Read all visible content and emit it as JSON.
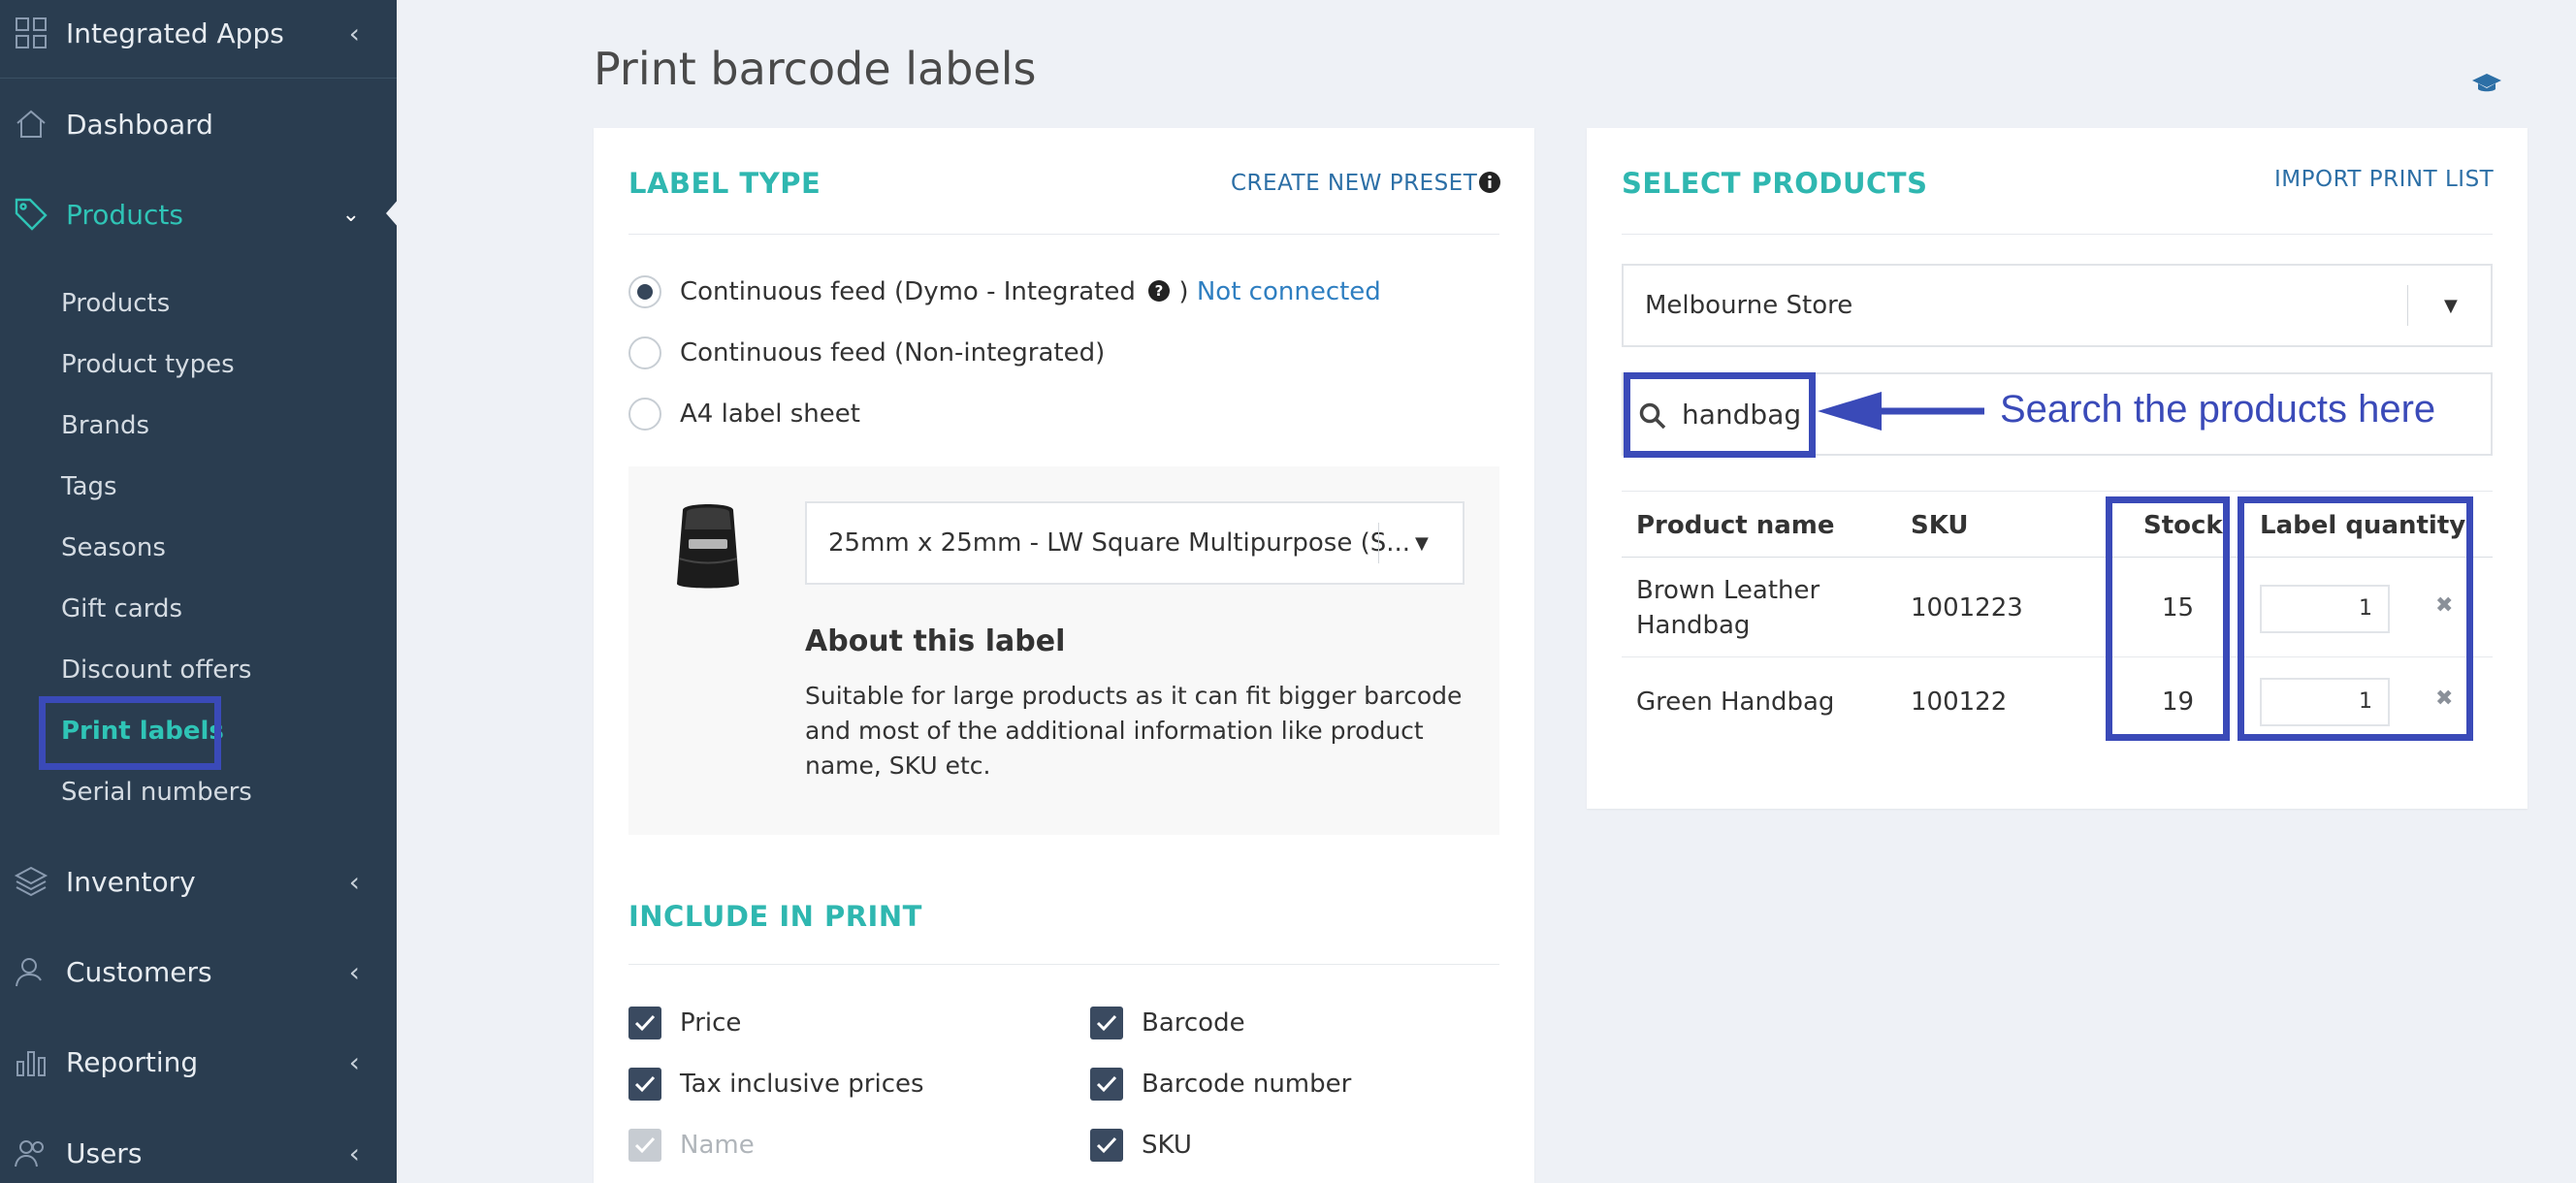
{
  "sidebar": {
    "integrated_apps": "Integrated Apps",
    "dashboard": "Dashboard",
    "products": "Products",
    "sub_items": [
      "Products",
      "Product types",
      "Brands",
      "Tags",
      "Seasons",
      "Gift cards",
      "Discount offers",
      "Print labels",
      "Serial numbers"
    ],
    "inventory": "Inventory",
    "customers": "Customers",
    "reporting": "Reporting",
    "users": "Users"
  },
  "page": {
    "title": "Print barcode labels"
  },
  "label_type": {
    "title": "LABEL TYPE",
    "create_preset": "CREATE NEW PRESET",
    "options": [
      {
        "label": "Continuous feed (Dymo - Integrated",
        "suffix": ")",
        "status": "Not connected",
        "checked": true
      },
      {
        "label": "Continuous feed (Non-integrated)",
        "checked": false
      },
      {
        "label": "A4 label sheet",
        "checked": false
      }
    ],
    "preset_select": "25mm x 25mm - LW Square Multipurpose (S...",
    "about_title": "About this label",
    "about_text": "Suitable for large products as it can fit bigger barcode and most of the additional information like product name, SKU etc."
  },
  "include": {
    "title": "INCLUDE IN PRINT",
    "left": [
      {
        "label": "Price",
        "checked": true,
        "disabled": false
      },
      {
        "label": "Tax inclusive prices",
        "checked": true,
        "disabled": false
      },
      {
        "label": "Name",
        "checked": true,
        "disabled": true
      }
    ],
    "right": [
      {
        "label": "Barcode",
        "checked": true
      },
      {
        "label": "Barcode number",
        "checked": true
      },
      {
        "label": "SKU",
        "checked": true
      }
    ]
  },
  "select_products": {
    "title": "SELECT PRODUCTS",
    "import": "IMPORT PRINT LIST",
    "store": "Melbourne Store",
    "search_value": "handbag",
    "annotation": "Search the products here",
    "columns": [
      "Product name",
      "SKU",
      "Stock",
      "Label quantity"
    ],
    "rows": [
      {
        "name_line1": "Brown Leather",
        "name_line2": "Handbag",
        "sku": "1001223",
        "stock": "15",
        "qty": "1"
      },
      {
        "name_line1": "Green Handbag",
        "name_line2": "",
        "sku": "100122",
        "stock": "19",
        "qty": "1"
      }
    ]
  },
  "colors": {
    "accent": "#2fb7b0",
    "sidebar": "#2a3d50",
    "highlight": "#3a4ab8",
    "link": "#2c6fa6"
  }
}
